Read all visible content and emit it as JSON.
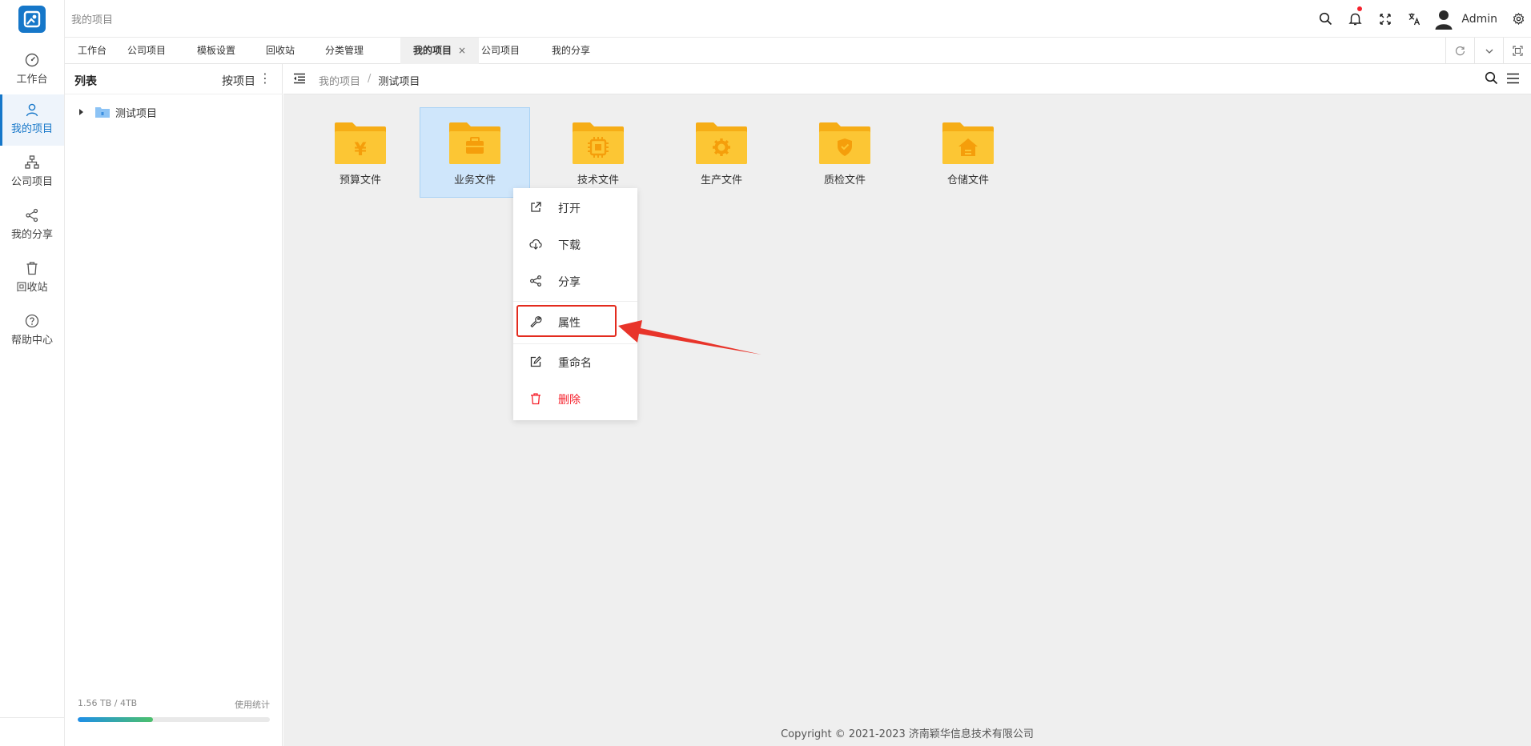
{
  "header": {
    "title": "我的项目",
    "user_name": "Admin",
    "notification_dot_color": "#f5222d"
  },
  "rail": {
    "items": [
      {
        "label": "工作台",
        "icon": "dashboard-icon"
      },
      {
        "label": "我的项目",
        "icon": "user-icon",
        "active": true
      },
      {
        "label": "公司项目",
        "icon": "org-chart-icon"
      },
      {
        "label": "我的分享",
        "icon": "share-icon"
      },
      {
        "label": "回收站",
        "icon": "trash-icon"
      },
      {
        "label": "帮助中心",
        "icon": "help-icon"
      }
    ]
  },
  "tabs": [
    {
      "label": "工作台"
    },
    {
      "label": "公司项目"
    },
    {
      "label": "模板设置"
    },
    {
      "label": "回收站"
    },
    {
      "label": "分类管理"
    },
    {
      "label": "我的项目",
      "active": true,
      "close": "×"
    },
    {
      "label": "公司项目"
    },
    {
      "label": "我的分享"
    }
  ],
  "side": {
    "title": "列表",
    "sort_label": "按项目",
    "more": "⋮",
    "tree": [
      {
        "label": "测试项目"
      }
    ],
    "usage": {
      "used_text": "1.56 TB / 4TB",
      "stats_link": "使用统计",
      "used_fraction": 0.39
    }
  },
  "breadcrumb": {
    "items": [
      "我的项目",
      "测试项目"
    ],
    "separator": "/"
  },
  "folders": [
    {
      "label": "预算文件",
      "icon": "yen-icon"
    },
    {
      "label": "业务文件",
      "icon": "briefcase-icon",
      "selected": true
    },
    {
      "label": "技术文件",
      "icon": "chip-icon"
    },
    {
      "label": "生产文件",
      "icon": "gear-icon"
    },
    {
      "label": "质检文件",
      "icon": "shield-icon"
    },
    {
      "label": "仓储文件",
      "icon": "warehouse-icon"
    }
  ],
  "context_menu": {
    "items": [
      {
        "label": "打开",
        "icon": "open-external-icon"
      },
      {
        "label": "下载",
        "icon": "cloud-download-icon"
      },
      {
        "label": "分享",
        "icon": "share-icon"
      },
      {
        "label": "属性",
        "icon": "wrench-icon",
        "highlighted": true
      },
      {
        "label": "重命名",
        "icon": "edit-icon"
      },
      {
        "label": "删除",
        "icon": "trash-icon",
        "danger": true
      }
    ]
  },
  "footer": {
    "copyright": "Copyright © 2021-2023 济南颖华信息技术有限公司"
  },
  "colors": {
    "brand": "#1677c9",
    "folder": "#fbbf24",
    "folder_symbol": "#f59e0b",
    "danger": "#f5222d",
    "annotation": "#e32b1e"
  }
}
